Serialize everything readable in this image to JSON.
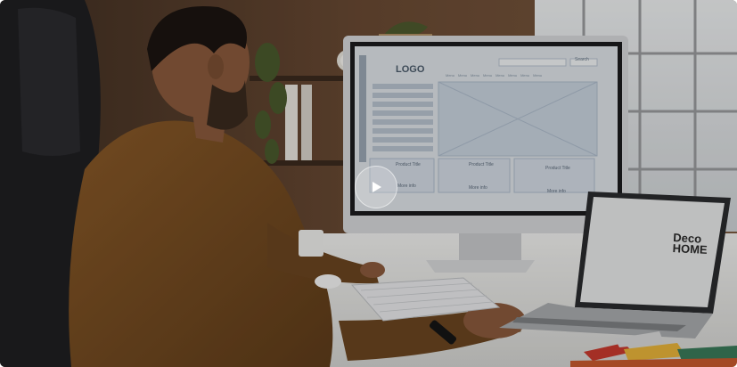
{
  "video": {
    "player_label": "",
    "play_icon": "play-icon"
  },
  "monitor": {
    "logo": "LOGO",
    "nav_items": [
      "Menu",
      "Menu",
      "Menu",
      "Menu",
      "Menu",
      "Menu",
      "Menu",
      "Menu"
    ],
    "search_button": "Search",
    "product_cards": [
      {
        "title": "Product Title",
        "button": "More info"
      },
      {
        "title": "Product Title",
        "button": "More info"
      },
      {
        "title": "Product Title",
        "button": "More info"
      }
    ]
  },
  "laptop": {
    "brand_line1": "Deco",
    "brand_line2": "HOME"
  },
  "colors": {
    "wall": "#5a4230",
    "window": "#d9dde0",
    "shirt": "#7a4f22",
    "desk": "#e6e6e4",
    "screen_bg": "#dfe3e8",
    "wireframe_blue": "#aebccc"
  }
}
